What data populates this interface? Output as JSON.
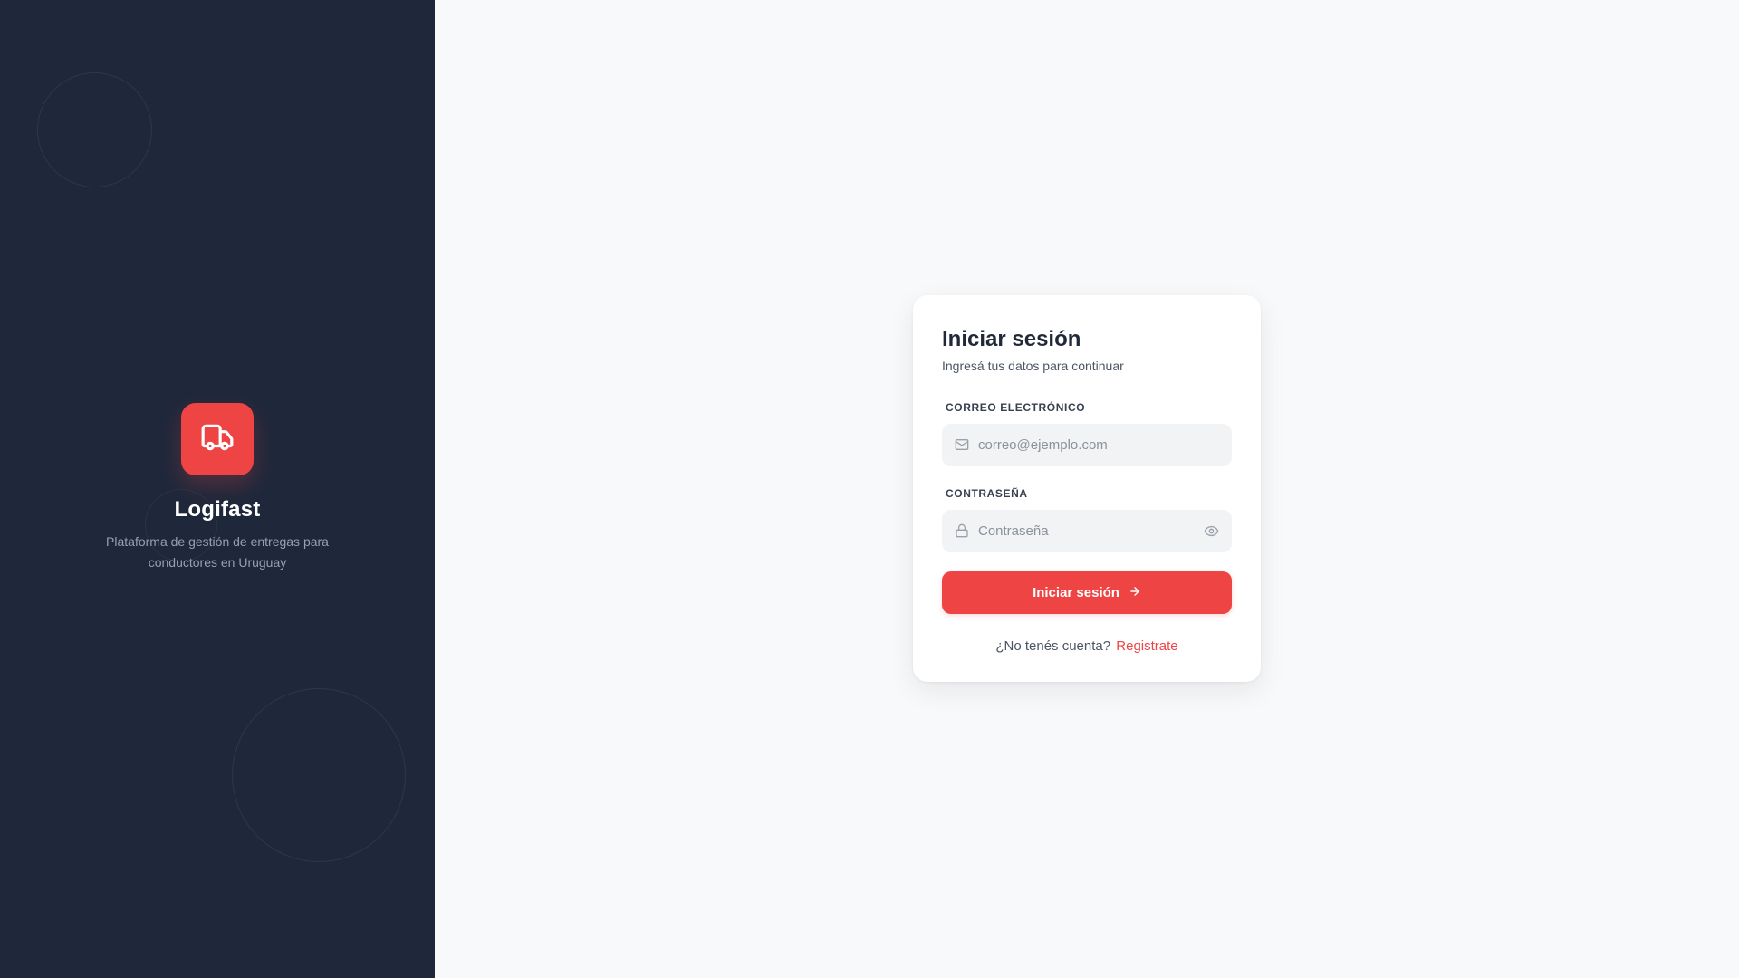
{
  "brand": {
    "name": "Logifast",
    "tagline": "Plataforma de gestión de entregas para conductores en Uruguay",
    "accent_color": "#ef4444",
    "panel_color": "#1f283b",
    "logo_icon": "truck-icon"
  },
  "login": {
    "title": "Iniciar sesión",
    "subtitle": "Ingresá tus datos para continuar",
    "email": {
      "label": "CORREO ELECTRÓNICO",
      "placeholder": "correo@ejemplo.com",
      "value": "",
      "icon": "mail-icon"
    },
    "password": {
      "label": "CONTRASEÑA",
      "placeholder": "Contraseña",
      "value": "",
      "icon": "lock-icon",
      "toggle_icon": "eye-icon"
    },
    "submit_label": "Iniciar sesión",
    "submit_icon": "arrow-right-icon",
    "no_account_text": "¿No tenés cuenta?",
    "register_link": "Registrate"
  }
}
